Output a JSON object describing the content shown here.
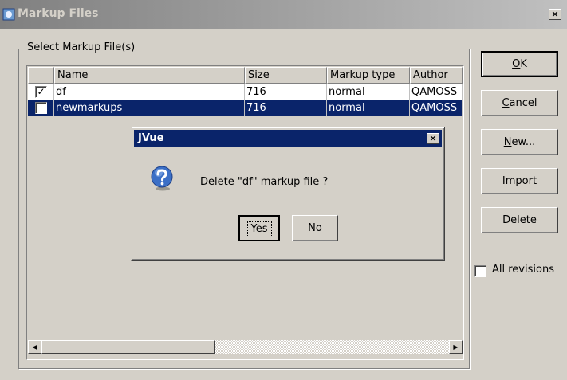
{
  "window": {
    "title": "Markup Files",
    "close": "×"
  },
  "group": {
    "legend": "Select Markup File(s)"
  },
  "table": {
    "columns": [
      "Name",
      "Size",
      "Markup type",
      "Author"
    ],
    "rows": [
      {
        "checked": true,
        "check_mark": "✓",
        "name": "df",
        "size": "716",
        "type": "normal",
        "author": "QAMOSS"
      },
      {
        "checked": false,
        "check_mark": "",
        "name": "newmarkups",
        "size": "716",
        "type": "normal",
        "author": "QAMOSS"
      }
    ],
    "scroll_left": "◀",
    "scroll_right": "▶"
  },
  "buttons": {
    "ok": {
      "mnemonic": "O",
      "rest": "K"
    },
    "cancel": {
      "mnemonic": "C",
      "rest": "ancel"
    },
    "new": {
      "mnemonic": "N",
      "rest": "ew..."
    },
    "import": "Import",
    "delete": "Delete"
  },
  "all_revisions": {
    "label": "All revisions",
    "checked": false
  },
  "dialog": {
    "title": "JVue",
    "message": "Delete \"df\" markup file ?",
    "yes": "Yes",
    "no": "No",
    "close": "×"
  },
  "colors": {
    "selection": "#0a246a",
    "face": "#d4d0c8"
  }
}
